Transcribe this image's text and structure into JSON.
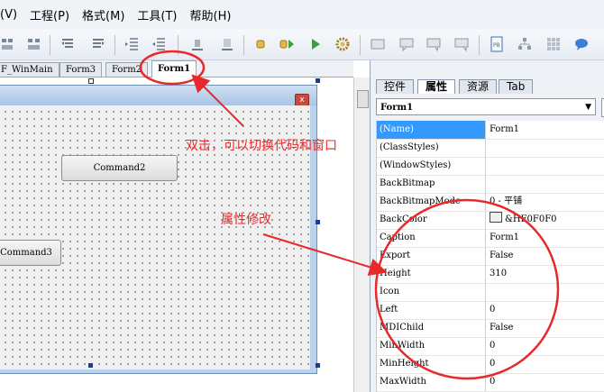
{
  "menu": {
    "items": [
      {
        "label": "(V)"
      },
      {
        "label": "工程(P)"
      },
      {
        "label": "格式(M)"
      },
      {
        "label": "工具(T)"
      },
      {
        "label": "帮助(H)"
      }
    ]
  },
  "toolbar": {
    "icons": [
      "align-left-icon",
      "align-center-icon",
      "undo-icon",
      "redo-icon",
      "indent-icon",
      "outdent-icon",
      "align-icon",
      "format-icon",
      "stop-icon",
      "step-icon",
      "run-icon",
      "gear-icon",
      "window-icon",
      "chat-icon",
      "chat-2-icon",
      "chat-3-icon",
      "properties-icon",
      "tree-icon",
      "grid-icon",
      "message-icon"
    ]
  },
  "doc_tabs": {
    "items": [
      {
        "label": "F_WinMain"
      },
      {
        "label": "Form3"
      },
      {
        "label": "Form2"
      },
      {
        "label": "Form1"
      }
    ],
    "active": "Form1"
  },
  "design": {
    "close_glyph": "x",
    "buttons": [
      {
        "label": "Command2"
      },
      {
        "label": "Command3"
      }
    ]
  },
  "panel": {
    "tabs": [
      {
        "label": "控件"
      },
      {
        "label": "属性"
      },
      {
        "label": "资源"
      },
      {
        "label": "Tab"
      }
    ],
    "active_tab": "属性",
    "object": "Form1",
    "properties": [
      {
        "name": "(Name)",
        "value": "Form1"
      },
      {
        "name": "(ClassStyles)",
        "value": ""
      },
      {
        "name": "(WindowStyles)",
        "value": ""
      },
      {
        "name": "BackBitmap",
        "value": ""
      },
      {
        "name": "BackBitmapMode",
        "value": "0 - 平铺"
      },
      {
        "name": "BackColor",
        "value": "&HF0F0F0"
      },
      {
        "name": "Caption",
        "value": "Form1"
      },
      {
        "name": "Export",
        "value": "False"
      },
      {
        "name": "Height",
        "value": "310"
      },
      {
        "name": "Icon",
        "value": ""
      },
      {
        "name": "Left",
        "value": "0"
      },
      {
        "name": "MDIChild",
        "value": "False"
      },
      {
        "name": "MinWidth",
        "value": "0"
      },
      {
        "name": "MinHeight",
        "value": "0"
      },
      {
        "name": "MaxWidth",
        "value": "0"
      }
    ]
  },
  "annotations": {
    "double_click_note": "双击，可以切换代码和窗口",
    "property_note": "属性修改",
    "color": "#e8282b"
  },
  "colors": {
    "selection": "#3399ff",
    "form_frame": "#b9d1ea"
  }
}
